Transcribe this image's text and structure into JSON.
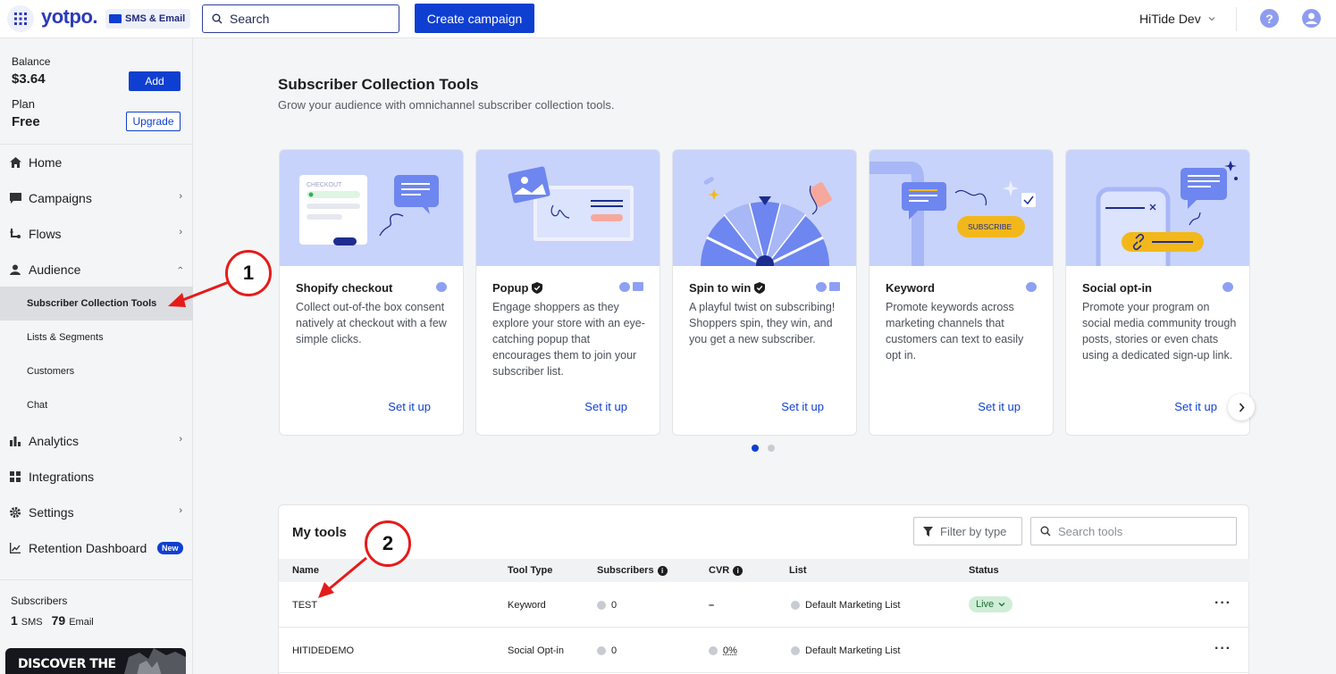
{
  "topbar": {
    "logo": "yotpo.",
    "product": "SMS & Email",
    "search_placeholder": "Search",
    "create_campaign": "Create campaign",
    "account_name": "HiTide Dev"
  },
  "sidebar": {
    "balance_label": "Balance",
    "balance_value": "$3.64",
    "add_label": "Add",
    "plan_label": "Plan",
    "plan_value": "Free",
    "upgrade_label": "Upgrade",
    "nav": {
      "home": "Home",
      "campaigns": "Campaigns",
      "flows": "Flows",
      "audience": "Audience",
      "subscriber_tools": "Subscriber Collection Tools",
      "lists": "Lists & Segments",
      "customers": "Customers",
      "chat": "Chat",
      "analytics": "Analytics",
      "integrations": "Integrations",
      "settings": "Settings",
      "retention": "Retention Dashboard",
      "new_badge": "New"
    },
    "subscribers_label": "Subscribers",
    "sms_count": "1",
    "sms_label": "SMS",
    "email_count": "79",
    "email_label": "Email",
    "promo_text": "DISCOVER THE"
  },
  "main": {
    "title": "Subscriber Collection Tools",
    "subtitle": "Grow your audience with omnichannel subscriber collection tools.",
    "cards": [
      {
        "title": "Shopify checkout",
        "desc": "Collect out-of-the box consent natively at checkout with a few simple clicks.",
        "link": "Set it up"
      },
      {
        "title": "Popup",
        "desc": "Engage shoppers as they explore your store with an eye-catching popup that encourages them to join your subscriber list.",
        "link": "Set it up"
      },
      {
        "title": "Spin to win",
        "desc": "A playful twist on subscribing! Shoppers spin, they win, and you get a new subscriber.",
        "link": "Set it up"
      },
      {
        "title": "Keyword",
        "desc": "Promote keywords across marketing channels that customers can text to easily opt in.",
        "link": "Set it up"
      },
      {
        "title": "Social opt-in",
        "desc": "Promote your program on social media community trough posts, stories or even chats using a dedicated sign-up link.",
        "link": "Set it up"
      }
    ],
    "illu_text": {
      "checkout": "CHECKOUT",
      "subscribe": "SUBSCRIBE"
    }
  },
  "tools": {
    "title": "My tools",
    "filter_label": "Filter by type",
    "search_placeholder": "Search tools",
    "columns": [
      "Name",
      "Tool Type",
      "Subscribers",
      "CVR",
      "List",
      "Status"
    ],
    "rows": [
      {
        "name": "TEST",
        "type": "Keyword",
        "subscribers": "0",
        "cvr": "–",
        "list": "Default Marketing List",
        "status": "Live"
      },
      {
        "name": "HITIDEDEMO",
        "type": "Social Opt-in",
        "subscribers": "0",
        "cvr": "0%",
        "list": "Default Marketing List",
        "status": ""
      }
    ]
  },
  "annotations": {
    "step1": "1",
    "step2": "2"
  },
  "colors": {
    "brand_blue": "#0f3fd1",
    "annotation_red": "#e51b1b",
    "card_illustration_bg": "#c8d3fb"
  }
}
